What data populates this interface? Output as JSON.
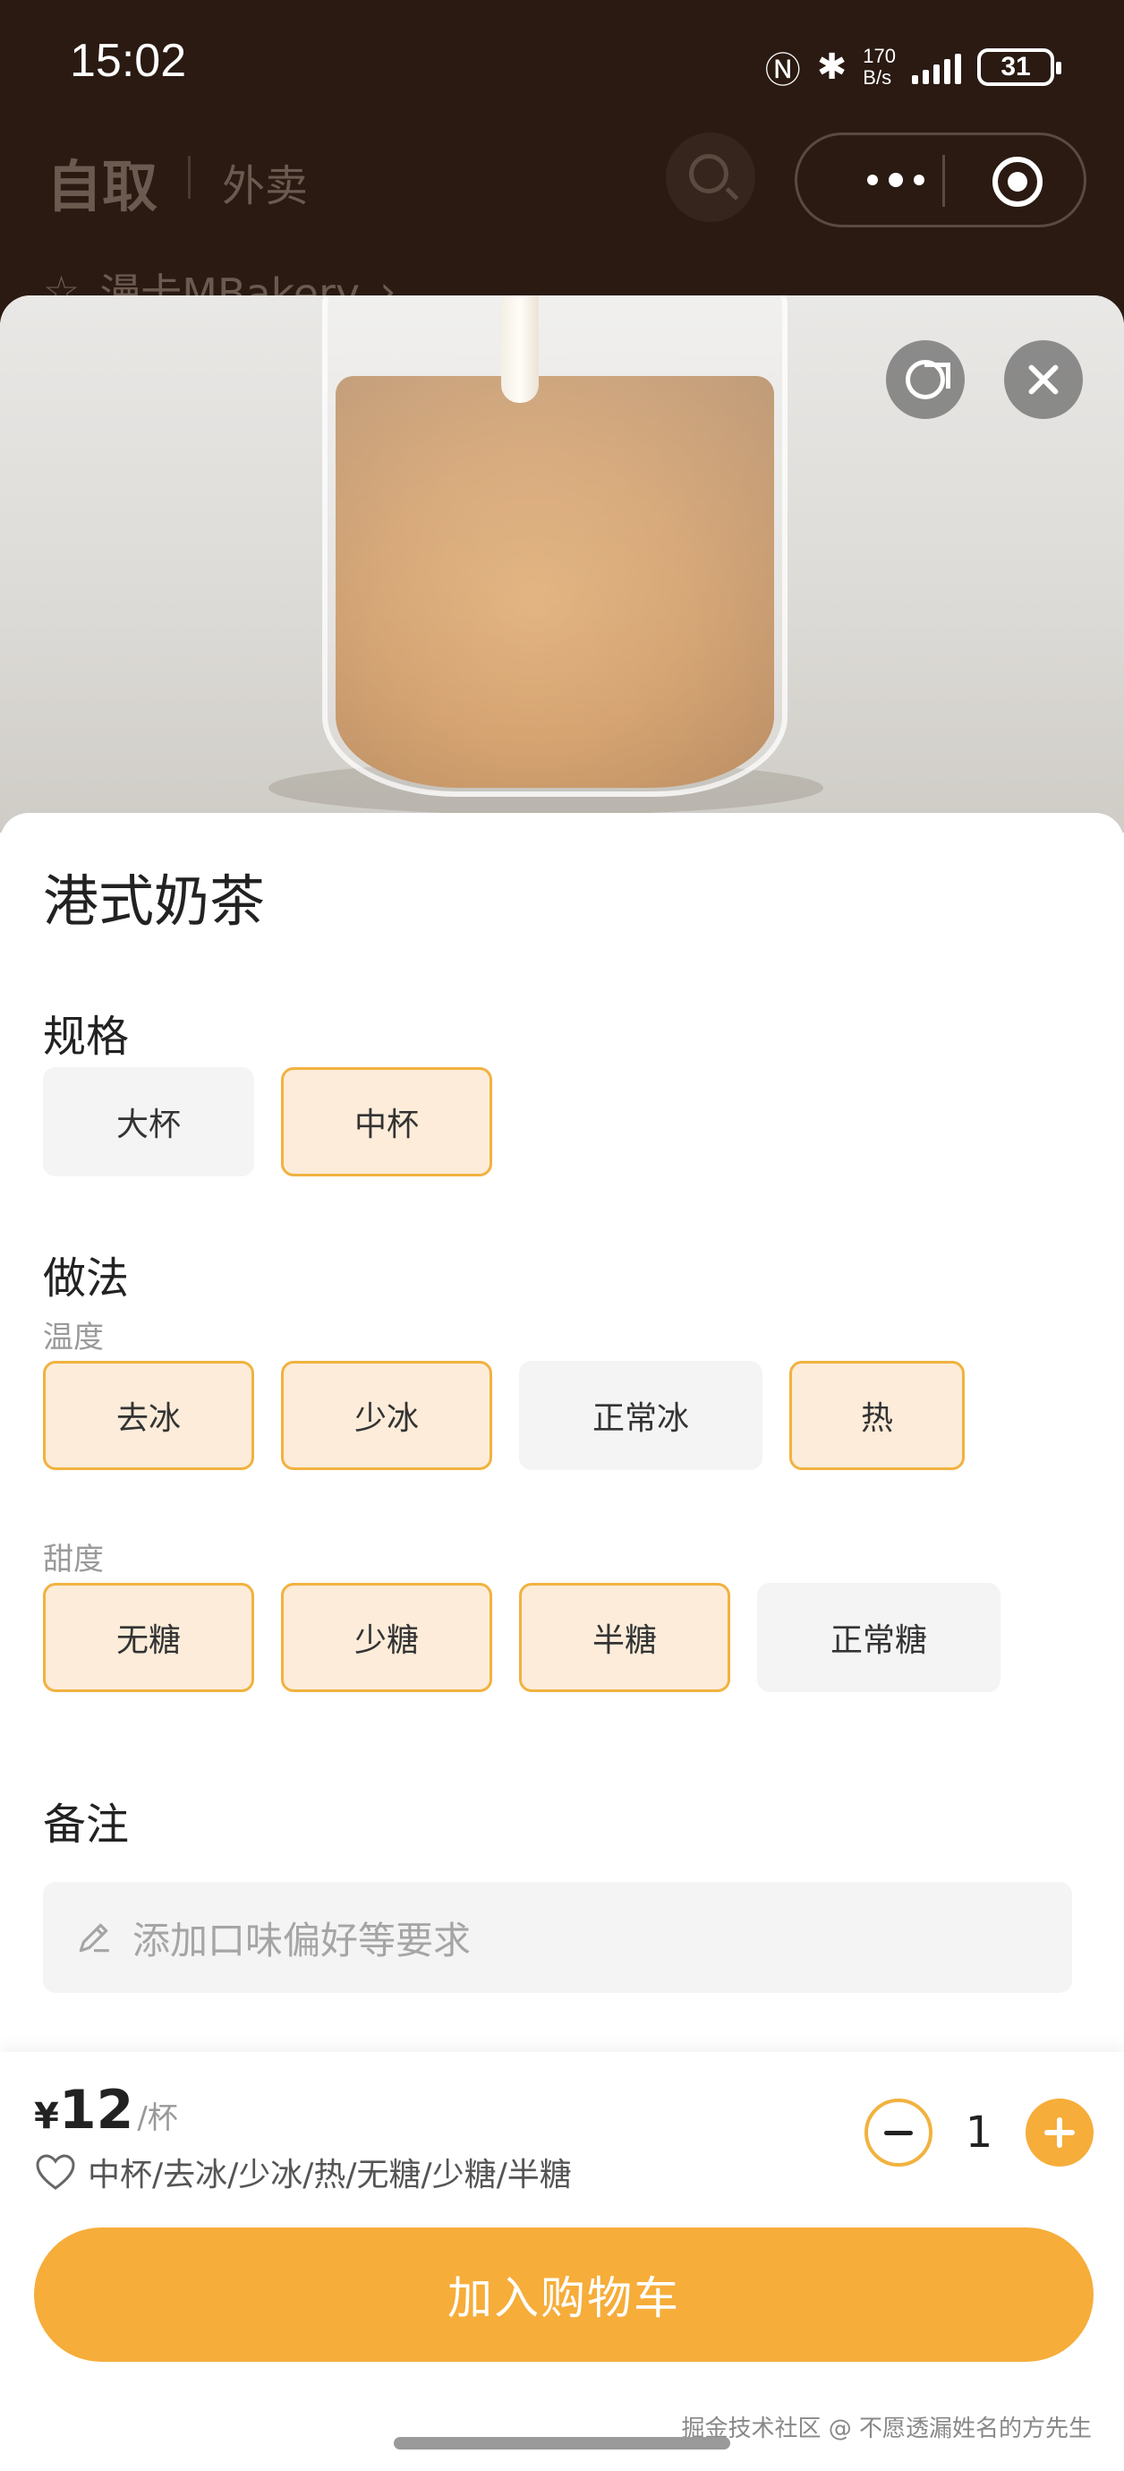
{
  "status_bar": {
    "time": "15:02",
    "net_speed_value": "170",
    "net_speed_unit": "B/s",
    "battery": "31"
  },
  "header": {
    "tab_pickup": "自取",
    "tab_delivery": "外卖",
    "store_name": "漫卡MBakery"
  },
  "product": {
    "name": "港式奶茶"
  },
  "spec": {
    "title": "规格",
    "options": [
      {
        "label": "大杯",
        "selected": false
      },
      {
        "label": "中杯",
        "selected": true
      }
    ]
  },
  "method": {
    "title": "做法",
    "temperature": {
      "title": "温度",
      "options": [
        {
          "label": "去冰",
          "selected": true
        },
        {
          "label": "少冰",
          "selected": true
        },
        {
          "label": "正常冰",
          "selected": false
        },
        {
          "label": "热",
          "selected": true
        }
      ]
    },
    "sweetness": {
      "title": "甜度",
      "options": [
        {
          "label": "无糖",
          "selected": true
        },
        {
          "label": "少糖",
          "selected": true
        },
        {
          "label": "半糖",
          "selected": true
        },
        {
          "label": "正常糖",
          "selected": false
        }
      ]
    }
  },
  "remark": {
    "title": "备注",
    "placeholder": "添加口味偏好等要求"
  },
  "bottom": {
    "currency": "¥",
    "price": "12",
    "unit": "/杯",
    "summary": "中杯/去冰/少冰/热/无糖/少糖/半糖",
    "quantity": "1",
    "add_to_cart": "加入购物车",
    "watermark": "掘金技术社区 @ 不愿透漏姓名的方先生"
  },
  "colors": {
    "accent": "#f6ad3a",
    "selected_bg": "#fcecd9",
    "selected_border": "#f1b23f",
    "header_bg": "#2a1a12"
  }
}
